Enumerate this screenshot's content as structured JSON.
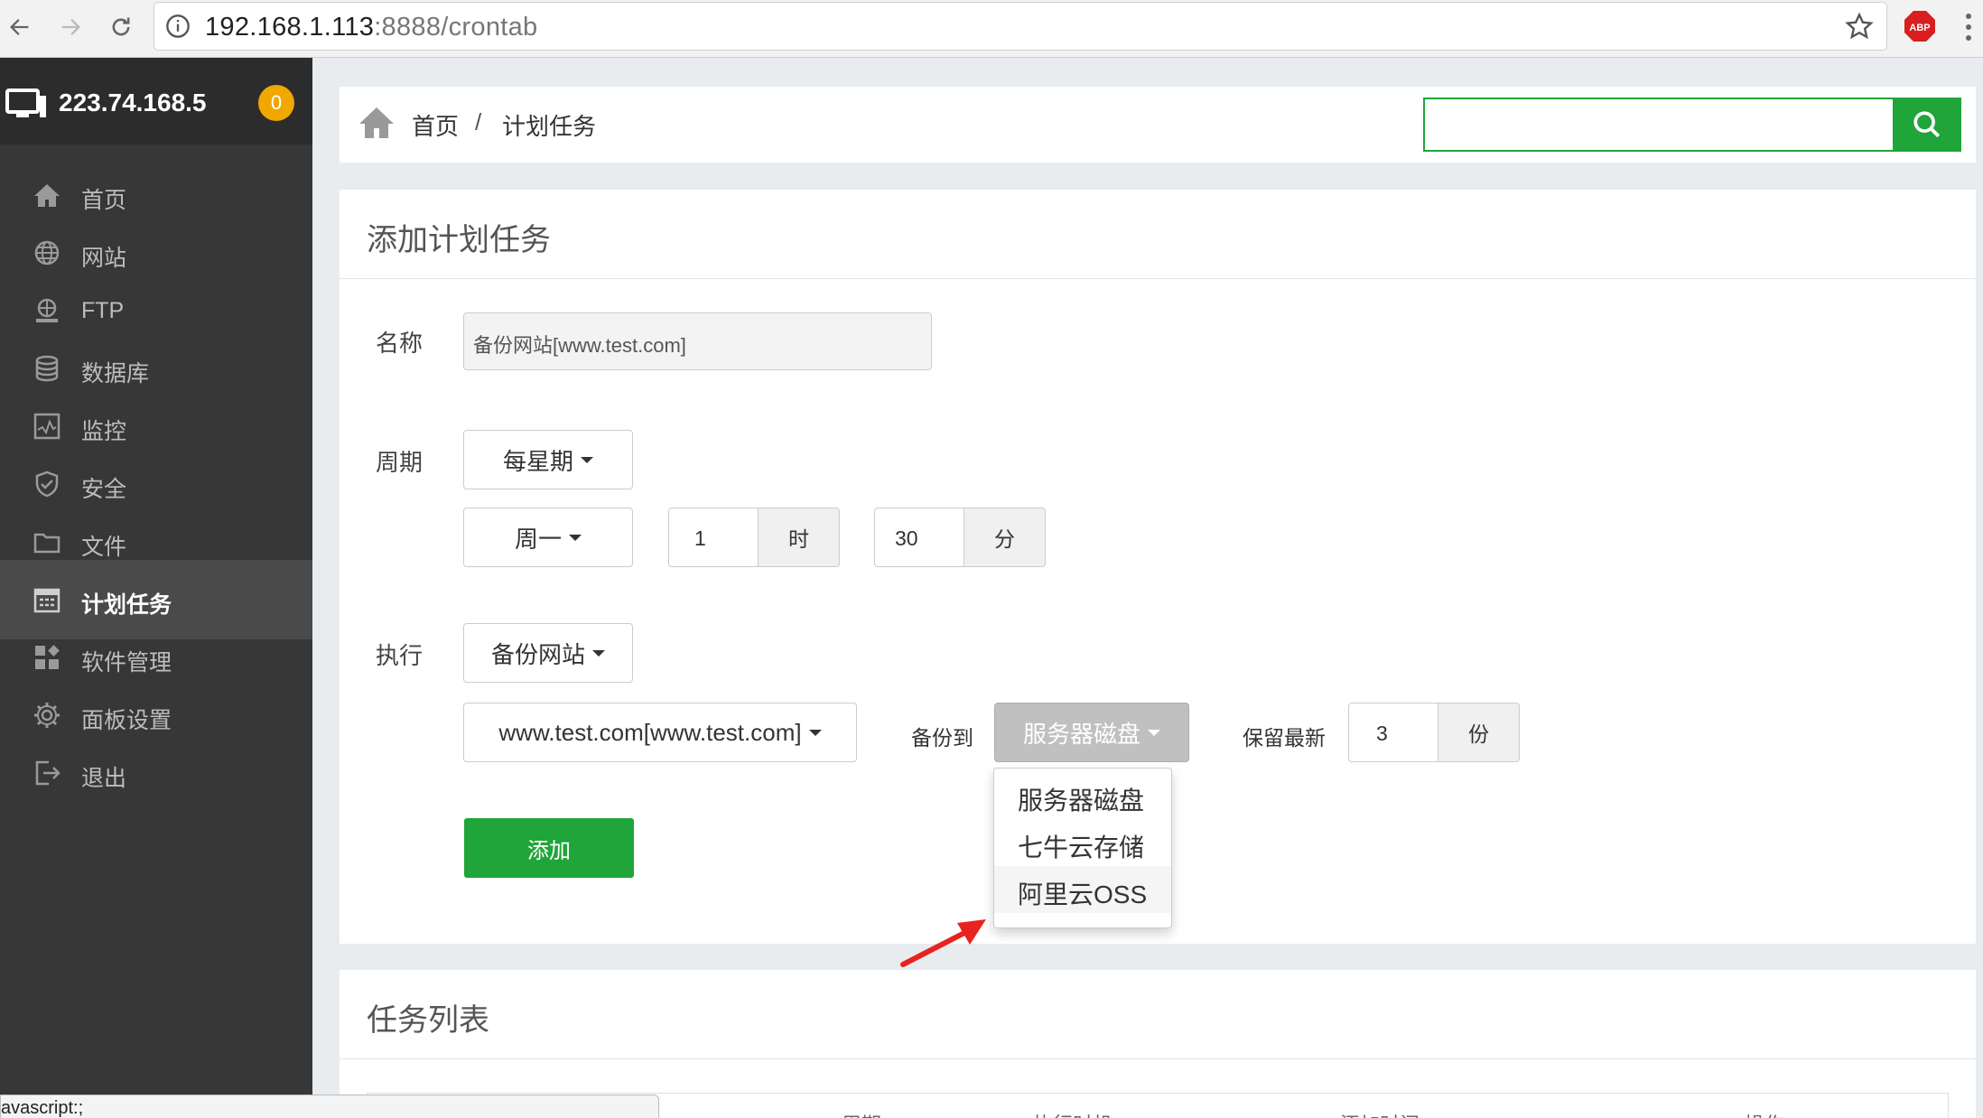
{
  "browser": {
    "url_host": "192.168.1.113",
    "url_path": ":8888/crontab",
    "extension": "ABP"
  },
  "sidebar": {
    "server_ip": "223.74.168.5",
    "badge_count": "0",
    "items": [
      {
        "label": "首页",
        "icon": "home-icon"
      },
      {
        "label": "网站",
        "icon": "globe-icon"
      },
      {
        "label": "FTP",
        "icon": "ftp-icon"
      },
      {
        "label": "数据库",
        "icon": "database-icon"
      },
      {
        "label": "监控",
        "icon": "monitor-chart-icon"
      },
      {
        "label": "安全",
        "icon": "shield-icon"
      },
      {
        "label": "文件",
        "icon": "folder-icon"
      },
      {
        "label": "计划任务",
        "icon": "calendar-icon",
        "active": true
      },
      {
        "label": "软件管理",
        "icon": "apps-icon"
      },
      {
        "label": "面板设置",
        "icon": "gear-icon"
      },
      {
        "label": "退出",
        "icon": "logout-icon"
      }
    ]
  },
  "breadcrumb": {
    "home": "首页",
    "separator": "/",
    "current": "计划任务"
  },
  "search": {
    "value": ""
  },
  "add_task": {
    "title": "添加计划任务",
    "name_label": "名称",
    "name_value": "备份网站[www.test.com]",
    "cycle_label": "周期",
    "cycle_value": "每星期",
    "weekday_value": "周一",
    "hour_value": "1",
    "hour_unit": "时",
    "minute_value": "30",
    "minute_unit": "分",
    "exec_label": "执行",
    "exec_value": "备份网站",
    "site_value": "www.test.com[www.test.com]",
    "backup_to_label": "备份到",
    "backup_to_value": "服务器磁盘",
    "keep_label": "保留最新",
    "keep_value": "3",
    "keep_unit": "份",
    "add_button": "添加"
  },
  "backup_menu": {
    "options": [
      "服务器磁盘",
      "七牛云存储",
      "阿里云OSS"
    ],
    "highlighted": "阿里云OSS"
  },
  "task_list": {
    "title": "任务列表",
    "columns": [
      "周期",
      "执行时机",
      "添加时间",
      "操作"
    ]
  },
  "status_bar": {
    "text": "avascript:;"
  },
  "colors": {
    "accent_green": "#20a53a",
    "sidebar_bg": "#373737",
    "badge_orange": "#f0a800",
    "arrow_red": "#e8231f"
  }
}
